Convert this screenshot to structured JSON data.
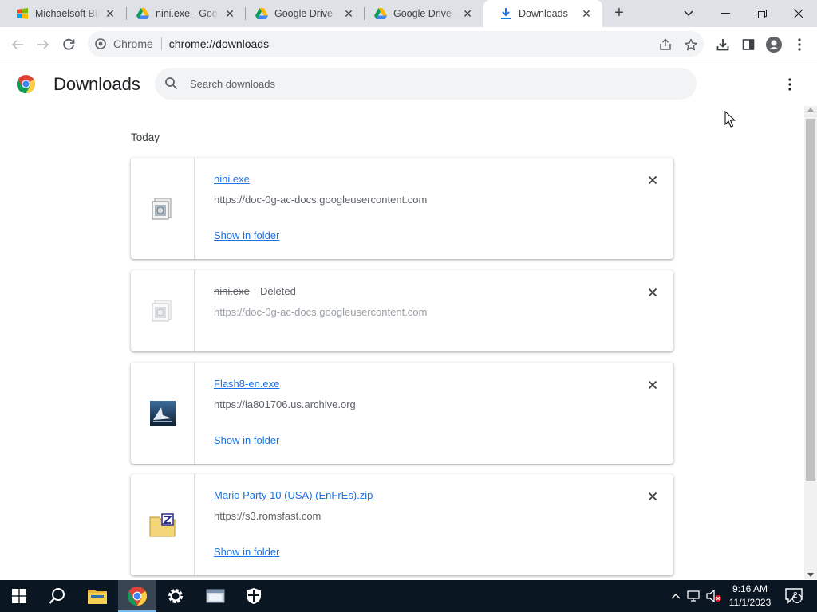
{
  "browser": {
    "tabs": [
      {
        "title": "Michaelsoft Binbows",
        "icon": "windows-flag-icon",
        "active": false
      },
      {
        "title": "nini.exe - Google Drive",
        "icon": "google-drive-icon",
        "active": false
      },
      {
        "title": "Google Drive - Virus scan warning",
        "icon": "google-drive-icon",
        "active": false
      },
      {
        "title": "Google Drive - Virus scan warning",
        "icon": "google-drive-icon",
        "active": false
      },
      {
        "title": "Downloads",
        "icon": "download-icon",
        "active": true
      }
    ],
    "new_tab_label": "+",
    "omnibox": {
      "chip": "Chrome",
      "url_scheme": "chrome://",
      "url_path": "downloads"
    }
  },
  "page": {
    "title": "Downloads",
    "search_placeholder": "Search downloads",
    "section": "Today",
    "downloads": [
      {
        "name": "nini.exe",
        "url": "https://doc-0g-ac-docs.googleusercontent.com",
        "status": "",
        "action": "Show in folder",
        "deleted": false,
        "icon": "exe-file-icon"
      },
      {
        "name": "nini.exe",
        "url": "https://doc-0g-ac-docs.googleusercontent.com",
        "status": "Deleted",
        "action": "",
        "deleted": true,
        "icon": "exe-file-icon"
      },
      {
        "name": "Flash8-en.exe",
        "url": "https://ia801706.us.archive.org",
        "status": "",
        "action": "Show in folder",
        "deleted": false,
        "icon": "flash-installer-icon"
      },
      {
        "name": "Mario Party 10 (USA) (EnFrEs).zip",
        "url": "https://s3.romsfast.com",
        "status": "",
        "action": "Show in folder",
        "deleted": false,
        "icon": "zip-folder-icon"
      }
    ]
  },
  "taskbar": {
    "time": "9:16 AM",
    "date": "11/1/2023",
    "notification_count": "2"
  },
  "colors": {
    "accent": "#1a73e8",
    "tabstrip": "#dee1e6",
    "taskbar": "#0b1623"
  }
}
